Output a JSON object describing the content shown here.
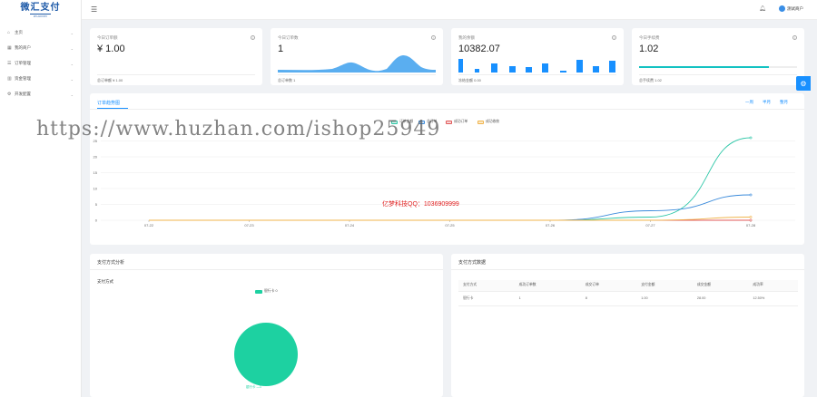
{
  "logo": {
    "title": "微汇支付",
    "subtitle": "W HUI PAY"
  },
  "sidebar": {
    "items": [
      {
        "label": "主页",
        "icon": "home-icon",
        "glyph": "⌂"
      },
      {
        "label": "我的商户",
        "icon": "merchant-icon",
        "glyph": "▦"
      },
      {
        "label": "订单管理",
        "icon": "order-icon",
        "glyph": "☰"
      },
      {
        "label": "资金管理",
        "icon": "money-icon",
        "glyph": "▥"
      },
      {
        "label": "开发配置",
        "icon": "code-icon",
        "glyph": "⚙"
      }
    ]
  },
  "header": {
    "user_name": "测试商户"
  },
  "stats": [
    {
      "title": "今日订单额",
      "value": "¥ 1.00",
      "foot": "总订单额 ¥ 1.00",
      "kind": "none"
    },
    {
      "title": "今日订单数",
      "value": "1",
      "foot": "总订单数 1",
      "kind": "area"
    },
    {
      "title": "我的余额",
      "value": "10382.07",
      "foot": "冻结金额 0.00",
      "kind": "bars"
    },
    {
      "title": "今日手续费",
      "value": "1.02",
      "foot": "总手续费 1.02",
      "kind": "progress",
      "progress": 0.82
    }
  ],
  "trend": {
    "tab_label": "订单趋势图",
    "periods": [
      "一周",
      "半月",
      "整月"
    ],
    "legend": [
      "订单金额",
      "总订单",
      "成功订单",
      "成功收款"
    ]
  },
  "chart_data": {
    "type": "line",
    "x": [
      "07-22",
      "07-23",
      "07-24",
      "07-25",
      "07-26",
      "07-27",
      "07-28"
    ],
    "yticks": [
      0,
      5,
      10,
      15,
      20,
      25
    ],
    "ylim": [
      0,
      28
    ],
    "series": [
      {
        "name": "订单金额",
        "color": "#2fc7a8",
        "values": [
          0,
          0,
          0,
          0,
          0,
          1,
          26
        ]
      },
      {
        "name": "总订单",
        "color": "#3b8bdb",
        "values": [
          0,
          0,
          0,
          0,
          0,
          3,
          8
        ]
      },
      {
        "name": "成功订单",
        "color": "#e05a5a",
        "values": [
          0,
          0,
          0,
          0,
          0,
          0,
          0
        ]
      },
      {
        "name": "成功收款",
        "color": "#f0b44c",
        "values": [
          0,
          0,
          0,
          0,
          0,
          0,
          1
        ]
      }
    ]
  },
  "overlay": {
    "watermark": "https://www.huzhan.com/ishop25949",
    "contact": "亿梦科技QQ：1036909999"
  },
  "pay_analysis": {
    "title": "支付方式分析",
    "subtitle": "支付方式",
    "legend": "银行卡 0",
    "pie_label": "银行卡 —1",
    "pie_color": "#1dd1a1"
  },
  "pay_data": {
    "title": "支付方式数据",
    "columns": [
      "支付方式",
      "成功订单数",
      "成交订单",
      "支付金额",
      "成交金额",
      "成功率"
    ],
    "rows": [
      [
        "银行卡",
        "1",
        "8",
        "1.00",
        "28.00",
        "12.50%"
      ]
    ]
  }
}
